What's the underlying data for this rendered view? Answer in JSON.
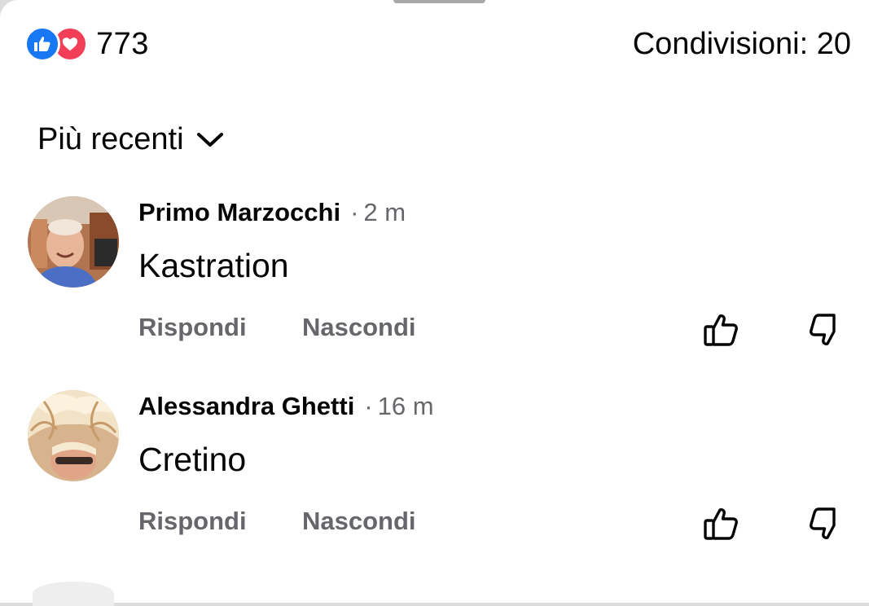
{
  "reactions": {
    "icons": [
      "like-icon",
      "love-icon"
    ],
    "count": "773",
    "colors": {
      "like": "#1877f2",
      "love": "#f33e58"
    }
  },
  "shares": {
    "label": "Condivisioni: 20"
  },
  "sort": {
    "label": "Più recenti"
  },
  "comments": [
    {
      "author": "Primo Marzocchi",
      "separator": "·",
      "time": "2 m",
      "text": "Kastration",
      "reply_label": "Rispondi",
      "hide_label": "Nascondi"
    },
    {
      "author": "Alessandra Ghetti",
      "separator": "·",
      "time": "16 m",
      "text": "Cretino",
      "reply_label": "Rispondi",
      "hide_label": "Nascondi"
    }
  ]
}
